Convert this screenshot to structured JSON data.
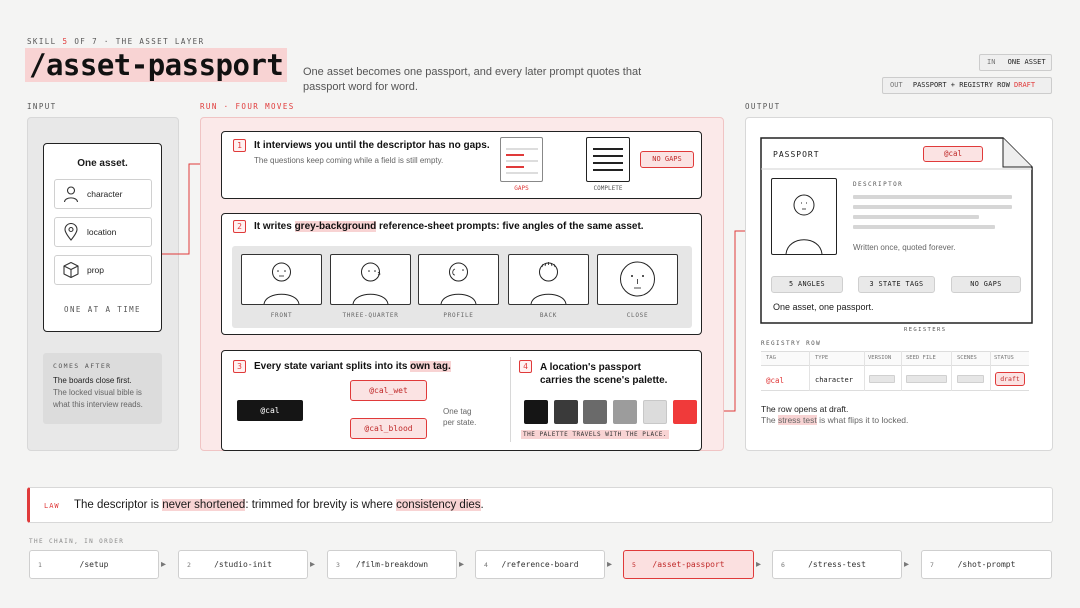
{
  "header": {
    "kicker_prefix": "SKILL",
    "kicker_num": "5",
    "kicker_suffix": "OF 7  ·  THE ASSET LAYER",
    "title": "/asset-passport",
    "subtitle": "One asset becomes one passport, and every later prompt quotes that passport word for word.",
    "in_label": "IN",
    "in_value": "ONE ASSET",
    "out_label": "OUT",
    "out_value": "PASSPORT + REGISTRY ROW",
    "out_draft": "DRAFT"
  },
  "input": {
    "section_label": "INPUT",
    "card_title": "One asset.",
    "types": [
      {
        "label": "character",
        "icon": "person-icon"
      },
      {
        "label": "location",
        "icon": "pin-icon"
      },
      {
        "label": "prop",
        "icon": "cube-icon"
      }
    ],
    "one_at_a_time": "ONE AT A TIME",
    "comes_after_label": "COMES AFTER",
    "comes_after_line1": "The boards close first.",
    "comes_after_line2": "The locked visual bible is what this interview reads."
  },
  "run": {
    "section_label": "RUN · FOUR MOVES",
    "step1": {
      "num": "1",
      "title": "It interviews you until the descriptor has no gaps.",
      "desc": "The questions keep coming while a field is still empty.",
      "gaps": "GAPS",
      "complete": "COMPLETE",
      "badge": "NO GAPS"
    },
    "step2": {
      "num": "2",
      "title_a": "It writes ",
      "title_hl": "grey-background",
      "title_b": " reference-sheet prompts: five angles of the same asset.",
      "angles": [
        "FRONT",
        "THREE-QUARTER",
        "PROFILE",
        "BACK",
        "CLOSE"
      ]
    },
    "step3": {
      "num": "3",
      "title_a": "Every state variant splits into its ",
      "title_hl": "own tag.",
      "base_tag": "@cal",
      "tag_wet": "@cal_wet",
      "tag_blood": "@cal_blood",
      "note_line1": "One tag",
      "note_line2": "per state."
    },
    "step4": {
      "num": "4",
      "title_line1": "A location's passport",
      "title_line2": "carries the scene's palette.",
      "caption": "THE PALETTE TRAVELS WITH THE PLACE.",
      "palette": [
        "#151515",
        "#3a3a3a",
        "#6a6a6a",
        "#9c9c9c",
        "#dcdcdc",
        "#f03a3a"
      ]
    }
  },
  "output": {
    "section_label": "OUTPUT",
    "passport_label": "PASSPORT",
    "tag": "@cal",
    "descriptor_label": "DESCRIPTOR",
    "descriptor_note": "Written once, quoted forever.",
    "pills": [
      "5 ANGLES",
      "3 STATE TAGS",
      "NO GAPS"
    ],
    "footer": "One asset, one passport.",
    "registers": "REGISTERS",
    "registry_label": "REGISTRY ROW",
    "columns": [
      "TAG",
      "TYPE",
      "VERSION",
      "SEED FILE",
      "SCENES",
      "STATUS"
    ],
    "row": {
      "tag": "@cal",
      "type": "character",
      "status": "draft"
    },
    "note_line1": "The row opens at draft.",
    "note_pre": "The ",
    "note_hl": "stress test",
    "note_post": " is what flips it to locked."
  },
  "law": {
    "label": "LAW",
    "text_a": "The descriptor is ",
    "hl1": "never shortened",
    "text_b": ": trimmed for brevity is where ",
    "hl2": "consistency dies",
    "text_c": "."
  },
  "chain": {
    "label": "THE CHAIN, IN ORDER",
    "items": [
      {
        "n": "1",
        "t": "/setup"
      },
      {
        "n": "2",
        "t": "/studio-init"
      },
      {
        "n": "3",
        "t": "/film-breakdown"
      },
      {
        "n": "4",
        "t": "/reference-board"
      },
      {
        "n": "5",
        "t": "/asset-passport"
      },
      {
        "n": "6",
        "t": "/stress-test"
      },
      {
        "n": "7",
        "t": "/shot-prompt"
      }
    ]
  },
  "colors": {
    "accent": "#e03a3a",
    "accent_soft": "#f8d3d3",
    "panel": "#fbe9e9"
  }
}
